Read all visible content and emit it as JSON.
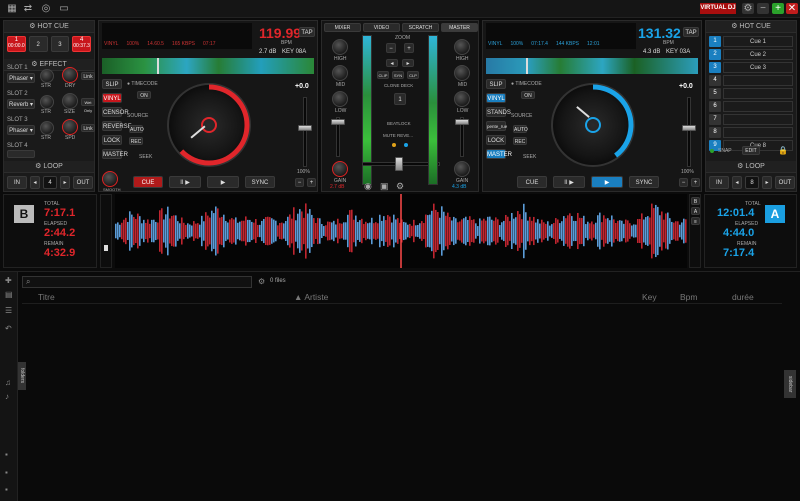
{
  "app": {
    "logo": "VIRTUAL DJ"
  },
  "left_panel": {
    "hot_cue_title": "HOT CUE",
    "hot_cues": [
      {
        "num": "1",
        "time": "00:00.0"
      },
      {
        "num": "2",
        "time": ""
      },
      {
        "num": "3",
        "time": ""
      },
      {
        "num": "4",
        "time": "00:37.3"
      }
    ],
    "effect_title": "EFFECT",
    "slots": [
      {
        "label": "SLOT 1",
        "effect": "Phaser",
        "knob1": "STR",
        "knob2": "DRY",
        "btn": "Link"
      },
      {
        "label": "SLOT 2",
        "effect": "Reverb",
        "knob1": "STR",
        "knob2": "SIZE",
        "btn": "Wet Only"
      },
      {
        "label": "SLOT 3",
        "effect": "Phaser",
        "knob1": "STR",
        "knob2": "SPD",
        "btn": "Link"
      },
      {
        "label": "SLOT 4",
        "effect": "",
        "knob1": "",
        "knob2": "",
        "btn": ""
      }
    ],
    "loop_title": "LOOP",
    "loop": {
      "in": "IN",
      "out": "OUT",
      "value": "4"
    }
  },
  "right_panel": {
    "hot_cue_title": "HOT CUE",
    "cues": [
      "Cue 1",
      "Cue 2",
      "Cue 3",
      "",
      "",
      "",
      "",
      "",
      "Cue 8"
    ],
    "snap": "SNAP",
    "edit": "EDIT",
    "loop_title": "LOOP",
    "loop": {
      "in": "IN",
      "out": "OUT",
      "value": "8"
    }
  },
  "deck_left": {
    "bpm": "119.99",
    "bpm_label": "BPM",
    "tap": "TAP",
    "gain_db": "2.7 dB",
    "key": "KEY 08A",
    "info": [
      "VINYL",
      "100%",
      "14.60.5",
      "165 KBPS",
      "07:17"
    ],
    "side_buttons": [
      "SLIP",
      "VINYL",
      "CENSOR",
      "REVERSE",
      "LOCK",
      "MASTER"
    ],
    "timecode": "TIMECODE",
    "on": "ON",
    "source": "SOURCE",
    "source_auto": "AUTO",
    "source_rec": "REC",
    "seek": "SEEK",
    "pitch_value": "+0.0",
    "pitch_pct": "100%",
    "cue": "CUE",
    "play_pause": "II ▶",
    "play": "▶",
    "sync": "SYNC",
    "smooth": "SMOOTH",
    "letter": "B",
    "total_label": "TOTAL",
    "total": "7:17.1",
    "elapsed_label": "ELAPSED",
    "elapsed": "2:44.2",
    "remain_label": "REMAIN",
    "remain": "4:32.9"
  },
  "deck_right": {
    "bpm": "131.32",
    "bpm_label": "BPM",
    "tap": "TAP",
    "gain_db": "4.3 dB",
    "key": "KEY 03A",
    "info": [
      "VINYL",
      "100%",
      "07:17.4",
      "144 KBPS",
      "12:01"
    ],
    "side_buttons": [
      "SLIP",
      "VINYL",
      "STANDS",
      "pente_rue",
      "LOCK",
      "MASTER"
    ],
    "timecode": "TIMECODE",
    "on": "ON",
    "source": "SOURCE",
    "source_auto": "AUTO",
    "source_rec": "REC",
    "seek": "SEEK",
    "pitch_value": "+0.0",
    "pitch_pct": "100%",
    "cue": "CUE",
    "play_pause": "II ▶",
    "play": "▶",
    "sync": "SYNC",
    "smooth": "smooth...",
    "letter": "A",
    "total_label": "TOTAL",
    "total": "12:01.4",
    "elapsed_label": "ELAPSED",
    "elapsed": "4:44.0",
    "remain_label": "REMAIN",
    "remain": "7:17.4"
  },
  "mixer": {
    "tabs": [
      "MIXER",
      "VIDEO",
      "SCRATCH",
      "MASTER"
    ],
    "zoom": "ZOOM",
    "left_eq": [
      "HIGH",
      "MID",
      "LOW",
      "GAIN"
    ],
    "right_eq": [
      "HIGH",
      "MID",
      "LOW",
      "GAIN"
    ],
    "gain_left": "2.7 dB",
    "gain_right": "4.3 dB",
    "center_btns": [
      "CLIP",
      "SYN",
      "CLP"
    ],
    "clone_deck": "CLONE DECK",
    "beatlock": "BEATLOCK",
    "mute_reverse": "MUTE REVE..."
  },
  "browser": {
    "search_placeholder": "",
    "files_count": "0 files",
    "columns": [
      "Titre",
      "Artiste",
      "Key",
      "Bpm",
      "durée"
    ],
    "left_tab": "folders",
    "right_tab": "sidebar"
  },
  "colors": {
    "left_accent": "#e0262b",
    "right_accent": "#1aa3e8",
    "bg": "#0b0b0b"
  }
}
